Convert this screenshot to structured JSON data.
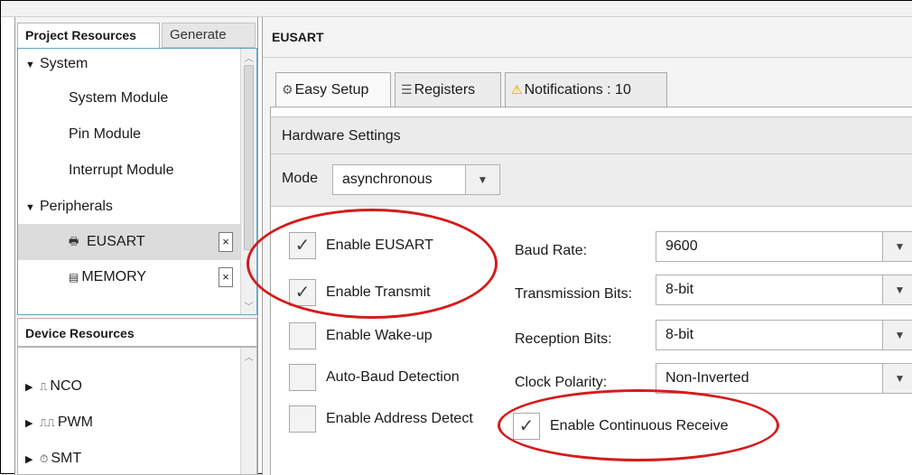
{
  "left_panel": {
    "tabs": [
      "Project Resources",
      "Generate"
    ],
    "project_tree": {
      "system_group": "System",
      "system_items": [
        "System Module",
        "Pin Module",
        "Interrupt Module"
      ],
      "peripherals_group": "Peripherals",
      "peripherals": [
        {
          "label": "EUSART",
          "icon": "printer-icon",
          "remove": "×"
        },
        {
          "label": "MEMORY",
          "icon": "memory-chip-icon",
          "remove": "×"
        }
      ]
    },
    "device_resources_title": "Device Resources",
    "device_resources": [
      {
        "label": "NCO",
        "icon": "pulse-icon"
      },
      {
        "label": "PWM",
        "icon": "pwm-icon"
      },
      {
        "label": "SMT",
        "icon": "timer-icon"
      }
    ]
  },
  "main": {
    "title": "EUSART",
    "tabs": [
      {
        "label": "Easy Setup",
        "icon": "gear-icon"
      },
      {
        "label": "Registers",
        "icon": "list-icon"
      },
      {
        "label": "Notifications : 10",
        "icon": "warning-icon"
      }
    ],
    "section_title": "Hardware Settings",
    "mode_label": "Mode",
    "mode_value": "asynchronous",
    "checkboxes": [
      {
        "label": "Enable EUSART",
        "checked": true
      },
      {
        "label": "Enable Transmit",
        "checked": true
      },
      {
        "label": "Enable Wake-up",
        "checked": false
      },
      {
        "label": "Auto-Baud Detection",
        "checked": false
      },
      {
        "label": "Enable Address Detect",
        "checked": false
      }
    ],
    "fields": [
      {
        "label": "Baud Rate:",
        "value": "9600"
      },
      {
        "label": "Transmission Bits:",
        "value": "8-bit"
      },
      {
        "label": "Reception Bits:",
        "value": "8-bit"
      },
      {
        "label": "Clock Polarity:",
        "value": "Non-Inverted"
      }
    ],
    "continuous_receive": {
      "label": "Enable Continuous Receive",
      "checked": true
    },
    "check_glyph": "✓",
    "annotation_color": "#d41c1c"
  }
}
